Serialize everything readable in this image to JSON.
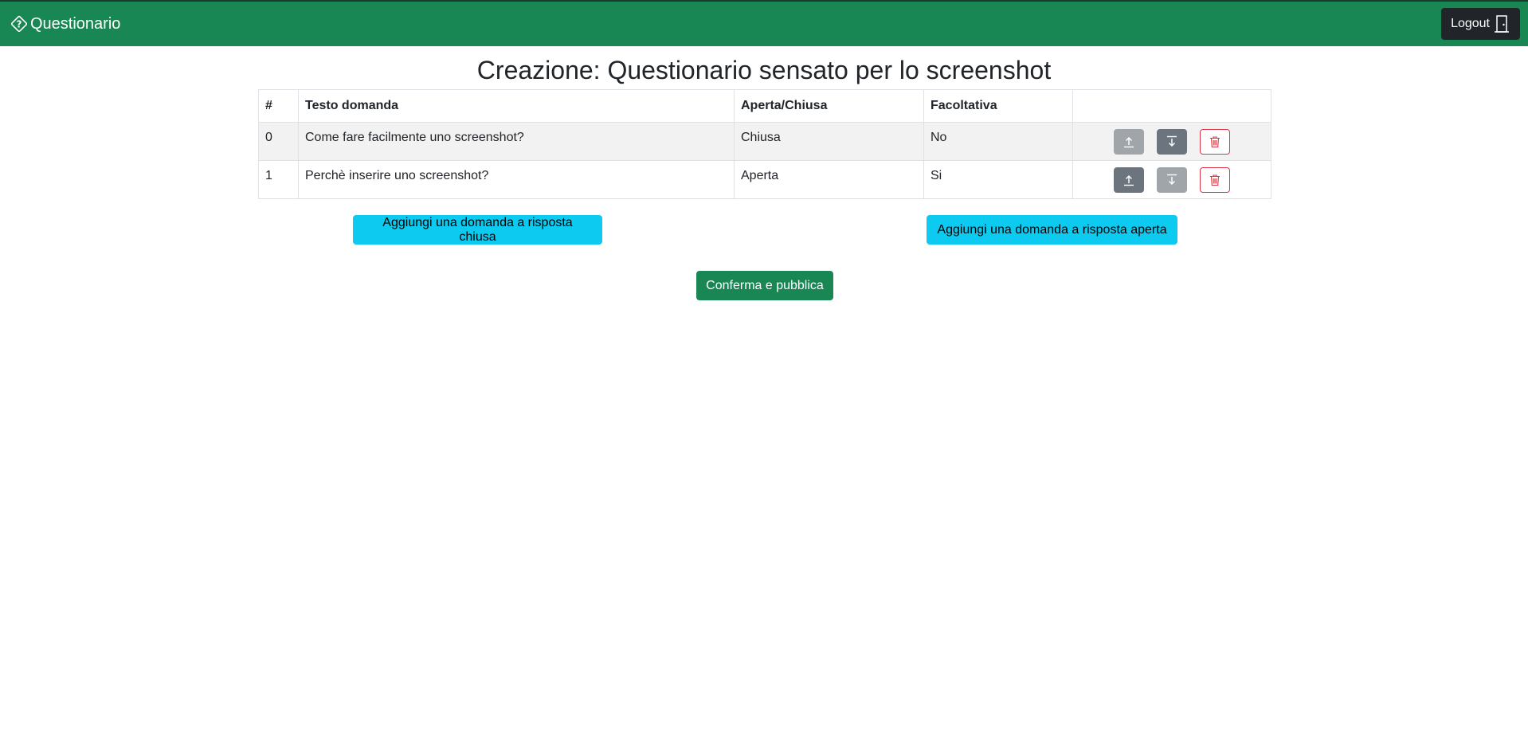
{
  "navbar": {
    "brand_label": "Questionario",
    "brand_icon": "question-diamond-icon",
    "logout_label": "Logout",
    "logout_icon": "door-icon"
  },
  "page": {
    "title": "Creazione: Questionario sensato per lo screenshot"
  },
  "table": {
    "headers": {
      "num": "#",
      "text": "Testo domanda",
      "type": "Aperta/Chiusa",
      "optional": "Facoltativa",
      "actions": ""
    },
    "rows": [
      {
        "num": "0",
        "text": "Come fare facilmente uno screenshot?",
        "type": "Chiusa",
        "optional": "No",
        "move_up_enabled": false,
        "move_down_enabled": true
      },
      {
        "num": "1",
        "text": "Perchè inserire uno screenshot?",
        "type": "Aperta",
        "optional": "Si",
        "move_up_enabled": true,
        "move_down_enabled": false
      }
    ]
  },
  "actions": {
    "add_closed_label": "Aggiungi una domanda a risposta chiusa",
    "add_open_label": "Aggiungi una domanda a risposta aperta",
    "confirm_label": "Conferma e pubblica"
  },
  "colors": {
    "primary_green": "#198754",
    "info_cyan": "#0dcaf0",
    "secondary_gray": "#6c757d",
    "danger_red": "#dc3545",
    "dark": "#212529"
  }
}
